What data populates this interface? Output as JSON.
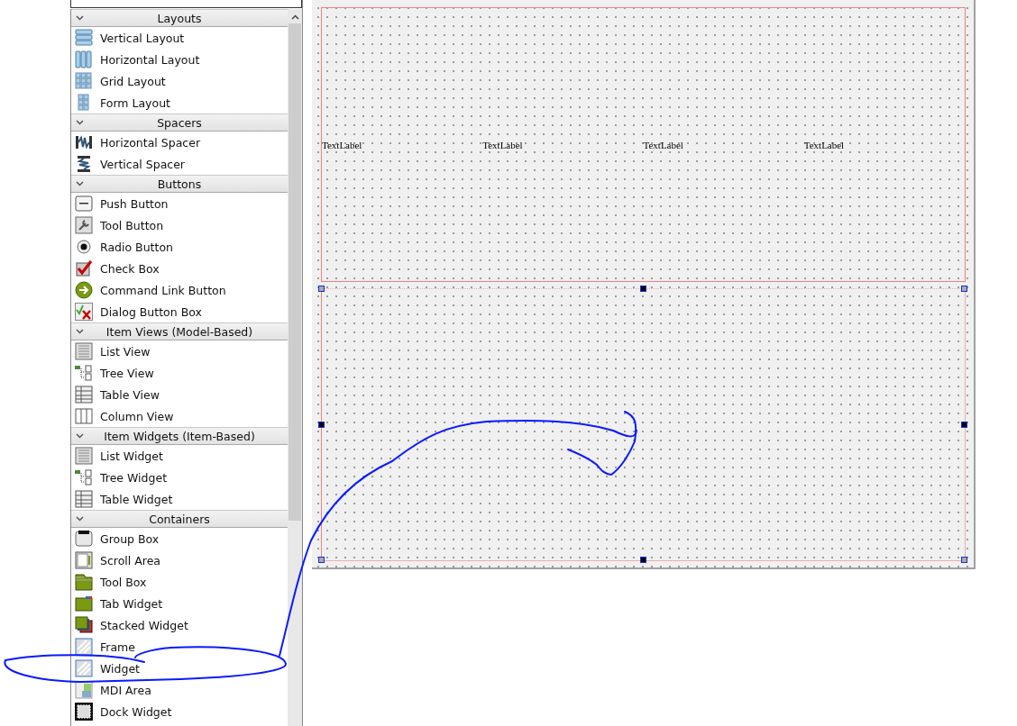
{
  "sections": [
    {
      "title": "Layouts",
      "expanded": true,
      "items": [
        "Vertical Layout",
        "Horizontal Layout",
        "Grid Layout",
        "Form Layout"
      ]
    },
    {
      "title": "Spacers",
      "expanded": true,
      "items": [
        "Horizontal Spacer",
        "Vertical Spacer"
      ]
    },
    {
      "title": "Buttons",
      "expanded": true,
      "items": [
        "Push Button",
        "Tool Button",
        "Radio Button",
        "Check Box",
        "Command Link Button",
        "Dialog Button Box"
      ]
    },
    {
      "title": "Item Views (Model-Based)",
      "expanded": true,
      "items": [
        "List View",
        "Tree View",
        "Table View",
        "Column View"
      ]
    },
    {
      "title": "Item Widgets (Item-Based)",
      "expanded": true,
      "items": [
        "List Widget",
        "Tree Widget",
        "Table Widget"
      ]
    },
    {
      "title": "Containers",
      "expanded": true,
      "items": [
        "Group Box",
        "Scroll Area",
        "Tool Box",
        "Tab Widget",
        "Stacked Widget",
        "Frame",
        "Widget",
        "MDI Area",
        "Dock Widget"
      ]
    }
  ],
  "form": {
    "labels": [
      "TextLabel",
      "TextLabel",
      "TextLabel",
      "TextLabel"
    ],
    "widget": {
      "selected": true
    }
  }
}
